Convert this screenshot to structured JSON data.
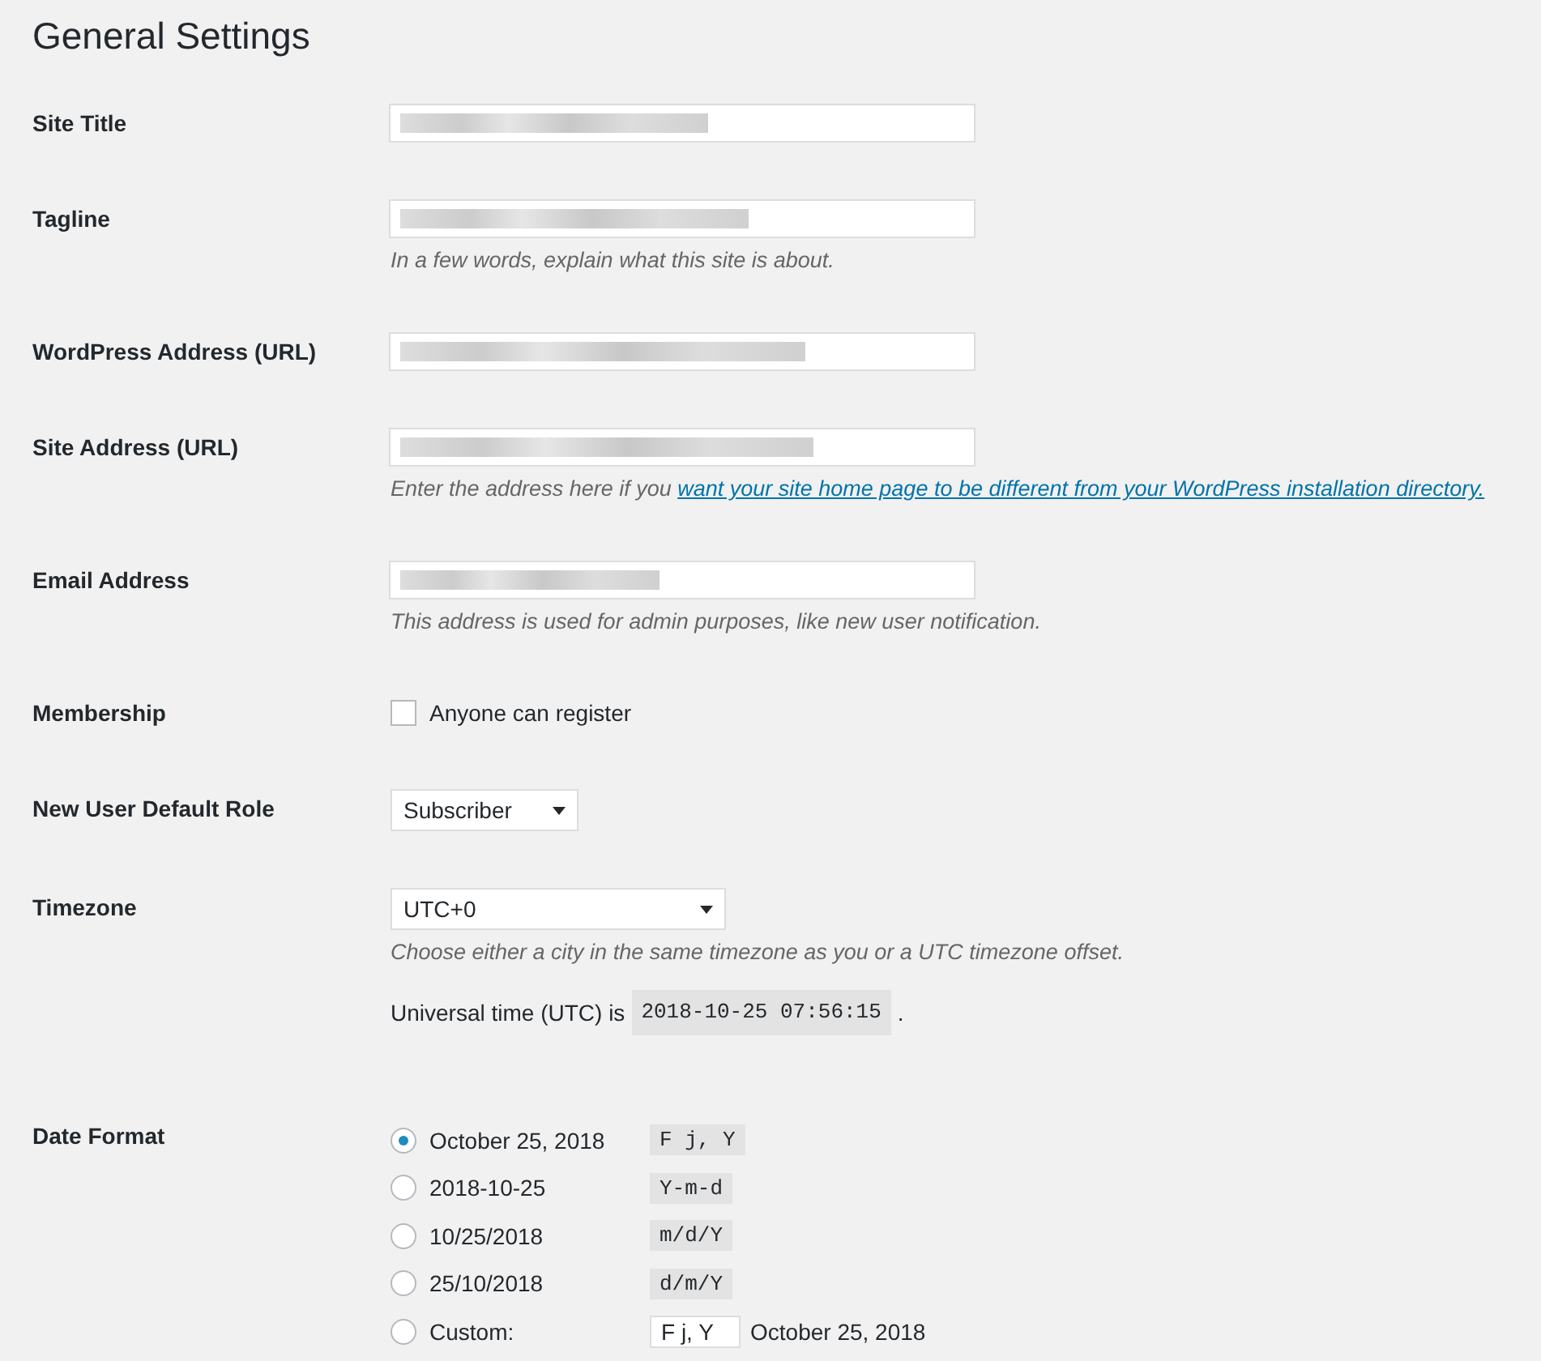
{
  "title": "General Settings",
  "rows": [
    {
      "kind": "text",
      "label": "Site Title"
    },
    {
      "kind": "text",
      "label": "Tagline",
      "description": "In a few words, explain what this site is about."
    },
    {
      "kind": "text",
      "label": "WordPress Address (URL)"
    },
    {
      "kind": "text",
      "label": "Site Address (URL)",
      "description": "Enter the address here if you",
      "link": "want your site home page to be different from your WordPress installation directory."
    },
    {
      "kind": "text",
      "label": "Email Address",
      "description": "This address is used for admin purposes, like new user notification."
    },
    {
      "kind": "checkbox",
      "label": "Membership",
      "option": "Anyone can register",
      "checked": false
    },
    {
      "kind": "select",
      "label": "New User Default Role",
      "value": "Subscriber"
    },
    {
      "kind": "timezone",
      "label": "Timezone",
      "value": "UTC+0",
      "description": "Choose either a city in the same timezone as you or a UTC timezone offset.",
      "time_label": "Universal time (UTC) is",
      "time": "2018-10-25 07:56:15",
      "time_suffix": "."
    },
    {
      "kind": "radio",
      "label": "Date Format",
      "options": [
        {
          "label": "October 25, 2018",
          "code": "F j, Y",
          "selected": true
        },
        {
          "label": "2018-10-25",
          "code": "Y-m-d",
          "selected": false
        },
        {
          "label": "10/25/2018",
          "code": "m/d/Y",
          "selected": false
        },
        {
          "label": "25/10/2018",
          "code": "d/m/Y",
          "selected": false
        },
        {
          "label": "Custom:",
          "custom_value": "F j, Y",
          "preview": "October 25, 2018",
          "selected": false
        }
      ]
    }
  ]
}
